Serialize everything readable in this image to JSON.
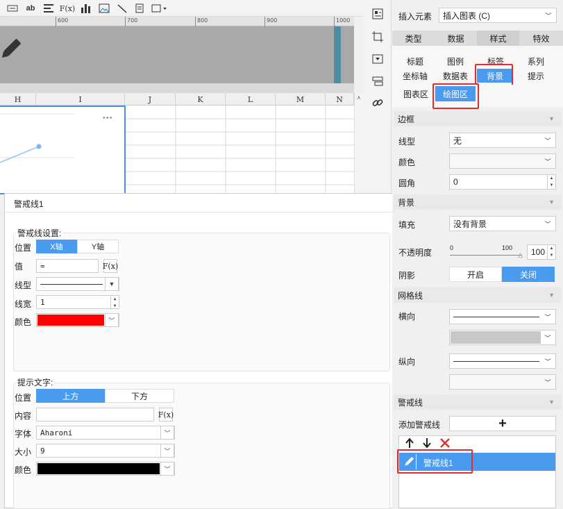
{
  "toolbar": {
    "icons": [
      "textbox-icon",
      "text-ab-icon",
      "align-icon",
      "formula-icon",
      "bar-chart-icon",
      "image-icon",
      "line-icon",
      "page-icon",
      "frame-dropdown-icon"
    ],
    "ab_label": "ab",
    "fx_label": "F(x)"
  },
  "ruler": {
    "labels": [
      "600",
      "700",
      "800",
      "900",
      "1000"
    ]
  },
  "sheet": {
    "columns": [
      "H",
      "I",
      "J",
      "K",
      "L",
      "M",
      "N"
    ],
    "chart_more": "•••"
  },
  "dialog": {
    "title": "警戒线1",
    "warning_settings": {
      "group_title": "警戒线设置:",
      "position_label": "位置",
      "position_options": [
        "X轴",
        "Y轴"
      ],
      "value_label": "值",
      "value": "=",
      "fx": "F(x)",
      "line_type_label": "线型",
      "line_width_label": "线宽",
      "line_width": "1",
      "color_label": "颜色",
      "color": "#ff0000"
    },
    "tip_text": {
      "group_title": "提示文字:",
      "position_label": "位置",
      "position_options": [
        "上方",
        "下方"
      ],
      "content_label": "内容",
      "content": "",
      "fx": "F(x)",
      "font_label": "字体",
      "font": "Aharoni",
      "size_label": "大小",
      "size": "9",
      "color_label": "颜色",
      "color": "#000000"
    }
  },
  "panel": {
    "insert_label": "插入元素",
    "insert_value": "插入图表 (C)",
    "main_tabs": [
      "类型",
      "数据",
      "样式",
      "特效"
    ],
    "style_tabs_row1": [
      "标题",
      "图例",
      "标签",
      "系列"
    ],
    "style_tabs_row2": [
      "坐标轴",
      "数据表",
      "背景",
      "提示"
    ],
    "area_tabs": [
      "图表区",
      "绘图区"
    ],
    "border": {
      "section": "边框",
      "line_type_label": "线型",
      "line_type": "无",
      "color_label": "颜色",
      "radius_label": "圆角",
      "radius": "0"
    },
    "background": {
      "section": "背景",
      "fill_label": "填充",
      "fill": "没有背景",
      "opacity_label": "不透明度",
      "opacity_min": "0",
      "opacity_max": "100",
      "opacity": "100",
      "shadow_label": "阴影",
      "shadow_on": "开启",
      "shadow_off": "关闭"
    },
    "gridlines": {
      "section": "网格线",
      "horizontal_label": "横向",
      "vertical_label": "纵向"
    },
    "warning_lines": {
      "section": "警戒线",
      "add_label": "添加警戒线",
      "add_symbol": "+",
      "items": [
        "警戒线1"
      ]
    }
  },
  "colors": {
    "accent": "#4a9af0",
    "highlight": "#e8282a"
  }
}
